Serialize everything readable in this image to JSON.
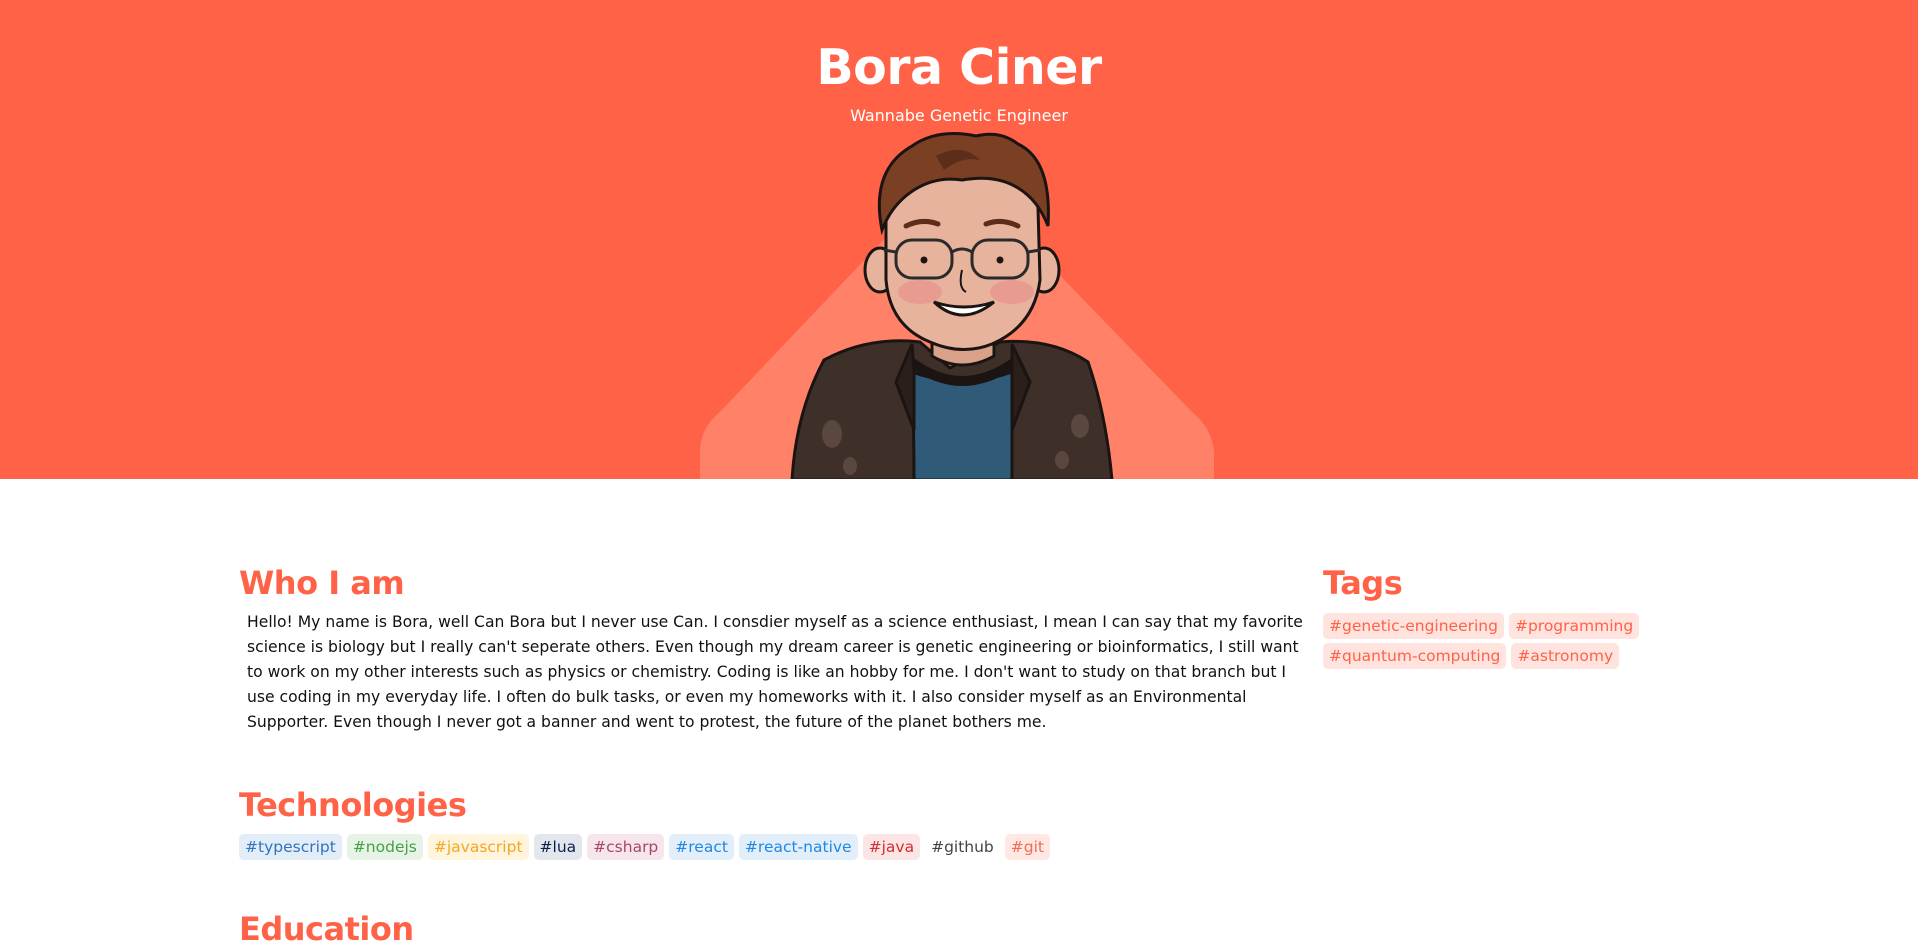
{
  "header": {
    "name": "Bora Ciner",
    "subtitle": "Wannabe Genetic Engineer"
  },
  "about": {
    "heading": "Who I am",
    "text": "Hello! My name is Bora, well Can Bora but I never use Can. I consdier myself as a science enthusiast, I mean I can say that my favorite science is biology but I really can't seperate others. Even though my dream career is genetic engineering or bioinformatics, I still want to work on my other interests such as physics or chemistry. Coding is like an hobby for me. I don't want to study on that branch but I use coding in my everyday life. I often do bulk tasks, or even my homeworks with it. I also consider myself as an Environmental Supporter. Even though I never got a banner and went to protest, the future of the planet bothers me."
  },
  "tags": {
    "heading": "Tags",
    "items": [
      {
        "label": "#genetic-engineering",
        "color": "#ff6247",
        "bg": "#ffe3de"
      },
      {
        "label": "#programming",
        "color": "#ff6247",
        "bg": "#ffe3de"
      },
      {
        "label": "#quantum-computing",
        "color": "#ff6247",
        "bg": "#ffe3de"
      },
      {
        "label": "#astronomy",
        "color": "#ff6247",
        "bg": "#ffe3de"
      }
    ]
  },
  "technologies": {
    "heading": "Technologies",
    "items": [
      {
        "label": "#typescript",
        "color": "#2f74c0",
        "bg": "#e3edf8"
      },
      {
        "label": "#nodejs",
        "color": "#43a047",
        "bg": "#e8f3e8"
      },
      {
        "label": "#javascript",
        "color": "#f5a623",
        "bg": "#fff4dc"
      },
      {
        "label": "#lua",
        "color": "#0b1f4d",
        "bg": "#e4e6ed"
      },
      {
        "label": "#csharp",
        "color": "#a9456e",
        "bg": "#f6e6ec"
      },
      {
        "label": "#react",
        "color": "#1e88e5",
        "bg": "#e3eefb"
      },
      {
        "label": "#react-native",
        "color": "#1e88e5",
        "bg": "#e3eefb"
      },
      {
        "label": "#java",
        "color": "#d32f2f",
        "bg": "#fbe5e5"
      },
      {
        "label": "#github",
        "color": "#444444",
        "bg": "#ffffff"
      },
      {
        "label": "#git",
        "color": "#f16d4f",
        "bg": "#ffe8e3"
      }
    ]
  },
  "education": {
    "heading": "Education"
  },
  "colors": {
    "accent": "#ff6247",
    "accent_light": "#ff8268",
    "text": "#111111"
  }
}
